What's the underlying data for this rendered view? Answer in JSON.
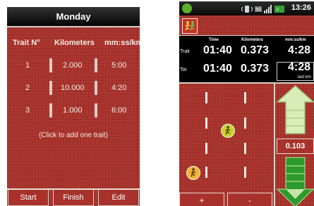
{
  "left": {
    "day_title": "Monday",
    "columns": [
      "Trait N°",
      "Kilometers",
      "mm:ss/km"
    ],
    "rows": [
      {
        "num": "1",
        "km": "2.000",
        "pace": "5:00"
      },
      {
        "num": "2",
        "km": "10.000",
        "pace": "4:20"
      },
      {
        "num": "3",
        "km": "1.000",
        "pace": "6:00"
      }
    ],
    "add_hint": "(Click to add one trait)",
    "buttons": {
      "start": "Start",
      "finish": "Finish",
      "edit": "Edit"
    }
  },
  "right": {
    "status_bar": {
      "clock": "13:26"
    },
    "stats": {
      "headers": {
        "time": "Time",
        "km": "Kilometers",
        "pace": "mm:ss/km"
      },
      "trait": {
        "label": "Trait",
        "time": "01:40",
        "km": "0.373",
        "pace": "4:28"
      },
      "total": {
        "label": "Tot",
        "time": "01:40",
        "km": "0.373",
        "pace": "4:28",
        "pace_sub": "last km"
      }
    },
    "speed_value": "0.103",
    "buttons": {
      "plus": "+",
      "minus": "-"
    },
    "icons": [
      "app-runner-icon",
      "notification-icon",
      "vibrate-icon",
      "signal-icon",
      "battery-icon",
      "up-arrow-icon",
      "down-arrow-icon",
      "runner-icon"
    ],
    "colors": {
      "track_red": "#a8322b",
      "runner_yellow": "#c7d22a",
      "arrow_green": "#2c9a2c",
      "arrow_light": "#d8ecb8"
    }
  }
}
